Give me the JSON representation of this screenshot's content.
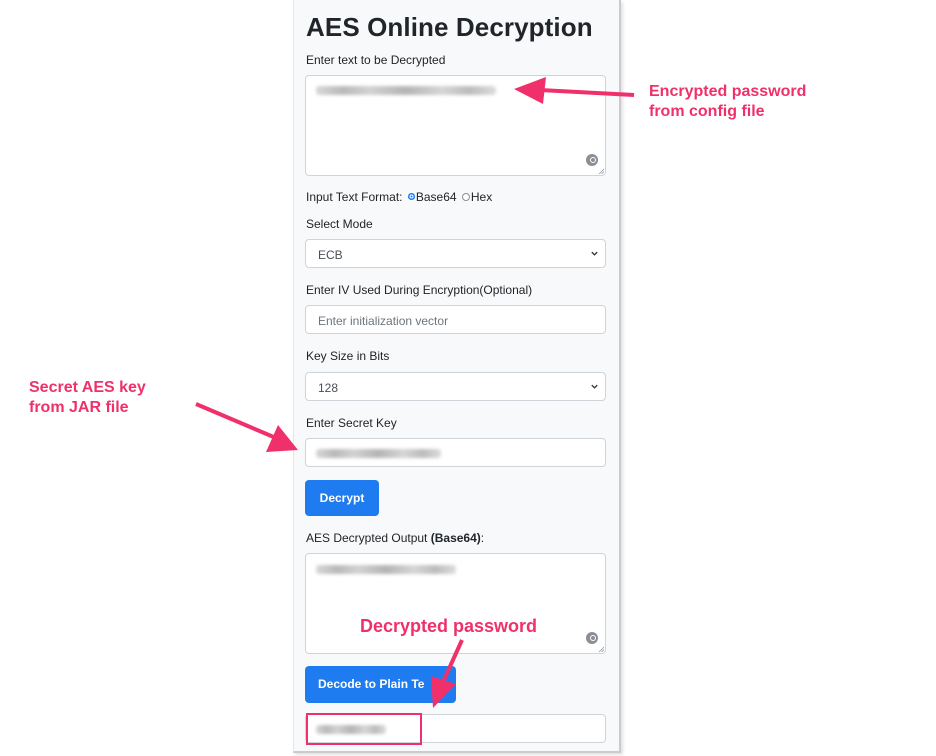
{
  "title": "AES Online Decryption",
  "input": {
    "label": "Enter text to be Decrypted"
  },
  "format": {
    "label": "Input Text Format:",
    "option1": "Base64",
    "option2": "Hex",
    "selected": "Base64"
  },
  "mode": {
    "label": "Select Mode",
    "value": "ECB"
  },
  "iv": {
    "label": "Enter IV Used During Encryption(Optional)",
    "placeholder": "Enter initialization vector"
  },
  "keysize": {
    "label": "Key Size in Bits",
    "value": "128"
  },
  "secret": {
    "label": "Enter Secret Key"
  },
  "decrypt_button": "Decrypt",
  "output": {
    "label_prefix": "AES Decrypted Output ",
    "label_bold": "(Base64)",
    "label_suffix": ":"
  },
  "decode_button": "Decode to Plain Te",
  "annotations": {
    "encrypted_line1": "Encrypted password",
    "encrypted_line2": "from config file",
    "secret_line1": "Secret AES key",
    "secret_line2": "from JAR file",
    "decrypted": "Decrypted password"
  },
  "colors": {
    "accent": "#1f7bf0",
    "annotation": "#f0306a",
    "panel": "#f8f9fa"
  }
}
